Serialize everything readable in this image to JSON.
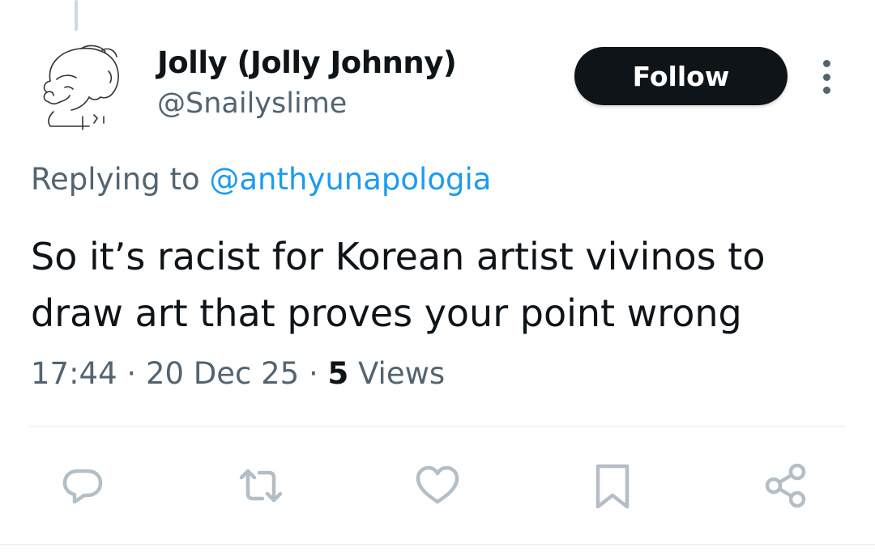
{
  "tweet": {
    "author_name": "Jolly (Jolly Johnny)",
    "author_handle": "@Snailyslime",
    "follow_label": "Follow",
    "replying_prefix": "Replying to",
    "replying_to": "@anthyunapologia",
    "text": "So it’s racist for Korean artist vivinos to draw art that proves your point wrong",
    "time": "17:44",
    "separator": "·",
    "date": "20 Dec 25",
    "views_count": "5",
    "views_label": "Views"
  },
  "actions": [
    {
      "icon": "reply-icon"
    },
    {
      "icon": "retweet-icon"
    },
    {
      "icon": "like-icon"
    },
    {
      "icon": "bookmark-icon"
    },
    {
      "icon": "share-icon"
    }
  ],
  "colors": {
    "text_primary": "#0f1419",
    "text_secondary": "#536471",
    "link": "#1d9bf0",
    "icon": "#b4bec6",
    "divider": "#eff3f4"
  }
}
